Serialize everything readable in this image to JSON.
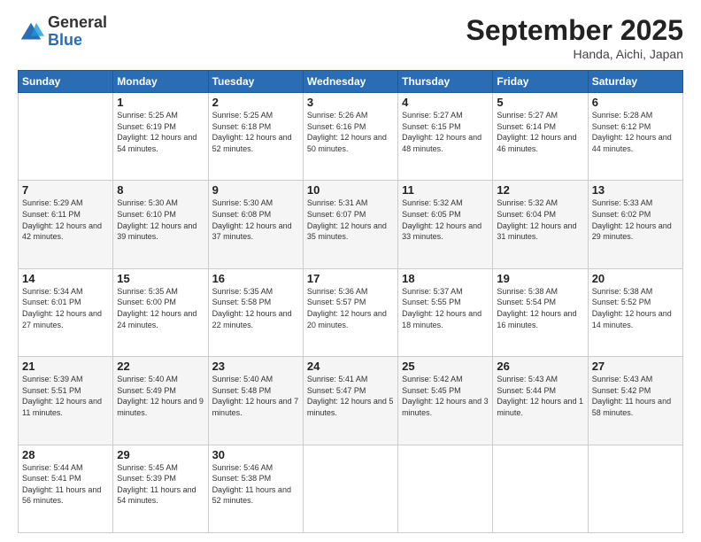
{
  "header": {
    "logo": {
      "general": "General",
      "blue": "Blue"
    },
    "title": "September 2025",
    "subtitle": "Handa, Aichi, Japan"
  },
  "weekdays": [
    "Sunday",
    "Monday",
    "Tuesday",
    "Wednesday",
    "Thursday",
    "Friday",
    "Saturday"
  ],
  "weeks": [
    [
      {
        "day": "",
        "sunrise": "",
        "sunset": "",
        "daylight": ""
      },
      {
        "day": "1",
        "sunrise": "Sunrise: 5:25 AM",
        "sunset": "Sunset: 6:19 PM",
        "daylight": "Daylight: 12 hours and 54 minutes."
      },
      {
        "day": "2",
        "sunrise": "Sunrise: 5:25 AM",
        "sunset": "Sunset: 6:18 PM",
        "daylight": "Daylight: 12 hours and 52 minutes."
      },
      {
        "day": "3",
        "sunrise": "Sunrise: 5:26 AM",
        "sunset": "Sunset: 6:16 PM",
        "daylight": "Daylight: 12 hours and 50 minutes."
      },
      {
        "day": "4",
        "sunrise": "Sunrise: 5:27 AM",
        "sunset": "Sunset: 6:15 PM",
        "daylight": "Daylight: 12 hours and 48 minutes."
      },
      {
        "day": "5",
        "sunrise": "Sunrise: 5:27 AM",
        "sunset": "Sunset: 6:14 PM",
        "daylight": "Daylight: 12 hours and 46 minutes."
      },
      {
        "day": "6",
        "sunrise": "Sunrise: 5:28 AM",
        "sunset": "Sunset: 6:12 PM",
        "daylight": "Daylight: 12 hours and 44 minutes."
      }
    ],
    [
      {
        "day": "7",
        "sunrise": "Sunrise: 5:29 AM",
        "sunset": "Sunset: 6:11 PM",
        "daylight": "Daylight: 12 hours and 42 minutes."
      },
      {
        "day": "8",
        "sunrise": "Sunrise: 5:30 AM",
        "sunset": "Sunset: 6:10 PM",
        "daylight": "Daylight: 12 hours and 39 minutes."
      },
      {
        "day": "9",
        "sunrise": "Sunrise: 5:30 AM",
        "sunset": "Sunset: 6:08 PM",
        "daylight": "Daylight: 12 hours and 37 minutes."
      },
      {
        "day": "10",
        "sunrise": "Sunrise: 5:31 AM",
        "sunset": "Sunset: 6:07 PM",
        "daylight": "Daylight: 12 hours and 35 minutes."
      },
      {
        "day": "11",
        "sunrise": "Sunrise: 5:32 AM",
        "sunset": "Sunset: 6:05 PM",
        "daylight": "Daylight: 12 hours and 33 minutes."
      },
      {
        "day": "12",
        "sunrise": "Sunrise: 5:32 AM",
        "sunset": "Sunset: 6:04 PM",
        "daylight": "Daylight: 12 hours and 31 minutes."
      },
      {
        "day": "13",
        "sunrise": "Sunrise: 5:33 AM",
        "sunset": "Sunset: 6:02 PM",
        "daylight": "Daylight: 12 hours and 29 minutes."
      }
    ],
    [
      {
        "day": "14",
        "sunrise": "Sunrise: 5:34 AM",
        "sunset": "Sunset: 6:01 PM",
        "daylight": "Daylight: 12 hours and 27 minutes."
      },
      {
        "day": "15",
        "sunrise": "Sunrise: 5:35 AM",
        "sunset": "Sunset: 6:00 PM",
        "daylight": "Daylight: 12 hours and 24 minutes."
      },
      {
        "day": "16",
        "sunrise": "Sunrise: 5:35 AM",
        "sunset": "Sunset: 5:58 PM",
        "daylight": "Daylight: 12 hours and 22 minutes."
      },
      {
        "day": "17",
        "sunrise": "Sunrise: 5:36 AM",
        "sunset": "Sunset: 5:57 PM",
        "daylight": "Daylight: 12 hours and 20 minutes."
      },
      {
        "day": "18",
        "sunrise": "Sunrise: 5:37 AM",
        "sunset": "Sunset: 5:55 PM",
        "daylight": "Daylight: 12 hours and 18 minutes."
      },
      {
        "day": "19",
        "sunrise": "Sunrise: 5:38 AM",
        "sunset": "Sunset: 5:54 PM",
        "daylight": "Daylight: 12 hours and 16 minutes."
      },
      {
        "day": "20",
        "sunrise": "Sunrise: 5:38 AM",
        "sunset": "Sunset: 5:52 PM",
        "daylight": "Daylight: 12 hours and 14 minutes."
      }
    ],
    [
      {
        "day": "21",
        "sunrise": "Sunrise: 5:39 AM",
        "sunset": "Sunset: 5:51 PM",
        "daylight": "Daylight: 12 hours and 11 minutes."
      },
      {
        "day": "22",
        "sunrise": "Sunrise: 5:40 AM",
        "sunset": "Sunset: 5:49 PM",
        "daylight": "Daylight: 12 hours and 9 minutes."
      },
      {
        "day": "23",
        "sunrise": "Sunrise: 5:40 AM",
        "sunset": "Sunset: 5:48 PM",
        "daylight": "Daylight: 12 hours and 7 minutes."
      },
      {
        "day": "24",
        "sunrise": "Sunrise: 5:41 AM",
        "sunset": "Sunset: 5:47 PM",
        "daylight": "Daylight: 12 hours and 5 minutes."
      },
      {
        "day": "25",
        "sunrise": "Sunrise: 5:42 AM",
        "sunset": "Sunset: 5:45 PM",
        "daylight": "Daylight: 12 hours and 3 minutes."
      },
      {
        "day": "26",
        "sunrise": "Sunrise: 5:43 AM",
        "sunset": "Sunset: 5:44 PM",
        "daylight": "Daylight: 12 hours and 1 minute."
      },
      {
        "day": "27",
        "sunrise": "Sunrise: 5:43 AM",
        "sunset": "Sunset: 5:42 PM",
        "daylight": "Daylight: 11 hours and 58 minutes."
      }
    ],
    [
      {
        "day": "28",
        "sunrise": "Sunrise: 5:44 AM",
        "sunset": "Sunset: 5:41 PM",
        "daylight": "Daylight: 11 hours and 56 minutes."
      },
      {
        "day": "29",
        "sunrise": "Sunrise: 5:45 AM",
        "sunset": "Sunset: 5:39 PM",
        "daylight": "Daylight: 11 hours and 54 minutes."
      },
      {
        "day": "30",
        "sunrise": "Sunrise: 5:46 AM",
        "sunset": "Sunset: 5:38 PM",
        "daylight": "Daylight: 11 hours and 52 minutes."
      },
      {
        "day": "",
        "sunrise": "",
        "sunset": "",
        "daylight": ""
      },
      {
        "day": "",
        "sunrise": "",
        "sunset": "",
        "daylight": ""
      },
      {
        "day": "",
        "sunrise": "",
        "sunset": "",
        "daylight": ""
      },
      {
        "day": "",
        "sunrise": "",
        "sunset": "",
        "daylight": ""
      }
    ]
  ]
}
